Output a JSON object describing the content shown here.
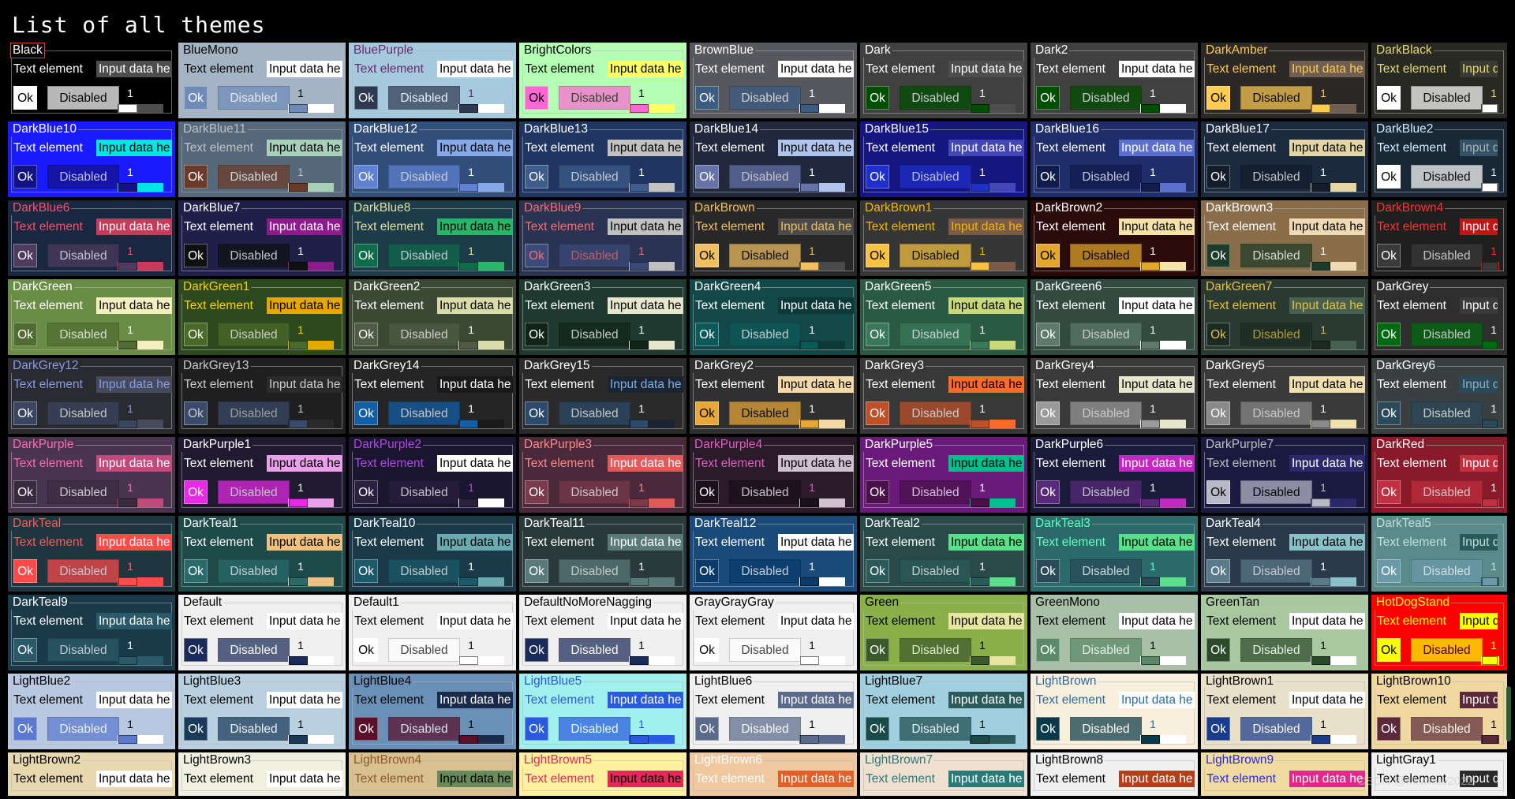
{
  "page": {
    "title": "List of all themes",
    "watermark": "CSDN @Mrwhite2022"
  },
  "labels": {
    "text_element": "Text element",
    "input_value": "Input data he",
    "input_value_narrow": "Input d",
    "ok": "Ok",
    "disabled": "Disabled",
    "slider_value": "1"
  },
  "themes": [
    {
      "name": "Black",
      "bg": "#000000",
      "fg": "#ffffff",
      "in_bg": "#4d4d4d",
      "in_fg": "#ffffff",
      "btn_bg": "#ffffff",
      "btn_fg": "#000000",
      "selected": true
    },
    {
      "name": "BlueMono",
      "bg": "#a5b4c4",
      "fg": "#000000",
      "in_bg": "#ffffff",
      "in_fg": "#000000",
      "btn_bg": "#6f8bba",
      "btn_fg": "#ffffff"
    },
    {
      "name": "BluePurple",
      "bg": "#a5cadd",
      "fg": "#6e266e",
      "in_bg": "#ffffff",
      "in_fg": "#000000",
      "btn_bg": "#303952",
      "btn_fg": "#ffffff"
    },
    {
      "name": "BrightColors",
      "bg": "#b4ffb4",
      "fg": "#000000",
      "in_bg": "#ffff66",
      "in_fg": "#000000",
      "btn_bg": "#fc67d3",
      "btn_fg": "#000000"
    },
    {
      "name": "BrownBlue",
      "bg": "#57575e",
      "fg": "#ffffff",
      "in_bg": "#ffffff",
      "in_fg": "#000000",
      "btn_bg": "#3c5c82",
      "btn_fg": "#ffffff"
    },
    {
      "name": "Dark",
      "bg": "#404040",
      "fg": "#ffffff",
      "in_bg": "#4d4d4d",
      "in_fg": "#ffffff",
      "btn_bg": "#004f00",
      "btn_fg": "#ffffff"
    },
    {
      "name": "Dark2",
      "bg": "#404040",
      "fg": "#ffffff",
      "in_bg": "#ffffff",
      "in_fg": "#000000",
      "btn_bg": "#004f00",
      "btn_fg": "#ffffff"
    },
    {
      "name": "DarkAmber",
      "bg": "#2c2825",
      "fg": "#fdcb52",
      "in_bg": "#705e52",
      "in_fg": "#fdcb52",
      "btn_bg": "#fdcb52",
      "btn_fg": "#000000"
    },
    {
      "name": "DarkBlack",
      "bg": "#282923",
      "fg": "#e7db74",
      "in_bg": "#393a32",
      "in_fg": "#e7db74",
      "btn_bg": "#ffffff",
      "btn_fg": "#000000"
    },
    {
      "name": "DarkBlue10",
      "bg": "#1a1aff",
      "fg": "#ffffff",
      "in_bg": "#00e6e6",
      "in_fg": "#000000",
      "btn_bg": "#121285",
      "btn_fg": "#ffffff"
    },
    {
      "name": "DarkBlue11",
      "bg": "#56697c",
      "fg": "#c0c0c0",
      "in_bg": "#a8d0b8",
      "in_fg": "#000000",
      "btn_bg": "#6c3a2a",
      "btn_fg": "#ffffff"
    },
    {
      "name": "DarkBlue12",
      "bg": "#324e7b",
      "fg": "#ffffff",
      "in_bg": "#86a8e7",
      "in_fg": "#000000",
      "btn_bg": "#5f81d3",
      "btn_fg": "#ffffff"
    },
    {
      "name": "DarkBlue13",
      "bg": "#203562",
      "fg": "#ffffff",
      "in_bg": "#c2c2c2",
      "in_fg": "#000000",
      "btn_bg": "#3e5c8c",
      "btn_fg": "#ffffff"
    },
    {
      "name": "DarkBlue14",
      "bg": "#21273d",
      "fg": "#ffffff",
      "in_bg": "#b1c4ec",
      "in_fg": "#000000",
      "btn_bg": "#6573a8",
      "btn_fg": "#ffffff"
    },
    {
      "name": "DarkBlue15",
      "bg": "#151680",
      "fg": "#ffffff",
      "in_bg": "#4346b5",
      "in_fg": "#ffffff",
      "btn_bg": "#1e2fcc",
      "btn_fg": "#ffffff"
    },
    {
      "name": "DarkBlue16",
      "bg": "#1f2e6a",
      "fg": "#ffffff",
      "in_bg": "#5b6fcc",
      "in_fg": "#ffffff",
      "btn_bg": "#101c4d",
      "btn_fg": "#ffffff"
    },
    {
      "name": "DarkBlue17",
      "bg": "#1c2a40",
      "fg": "#ffffff",
      "in_bg": "#e3d5a6",
      "in_fg": "#000000",
      "btn_bg": "#131c2a",
      "btn_fg": "#ffffff"
    },
    {
      "name": "DarkBlue2",
      "bg": "#1a2835",
      "fg": "#d1ecff",
      "in_bg": "#335267",
      "in_fg": "#acb1b4",
      "btn_bg": "#ffffff",
      "btn_fg": "#000000"
    },
    {
      "name": "DarkBlue6",
      "bg": "#1a2740",
      "fg": "#ff4d6d",
      "in_bg": "#c73a5a",
      "in_fg": "#ffffff",
      "btn_bg": "#4e3b5f",
      "btn_fg": "#ffffff"
    },
    {
      "name": "DarkBlue7",
      "bg": "#1f1f4a",
      "fg": "#ffffff",
      "in_bg": "#8c1b8c",
      "in_fg": "#ffffff",
      "btn_bg": "#101010",
      "btn_fg": "#ffffff"
    },
    {
      "name": "DarkBlue8",
      "bg": "#1c3c48",
      "fg": "#e0e0a0",
      "in_bg": "#2ab56a",
      "in_fg": "#000000",
      "btn_bg": "#0e6b4b",
      "btn_fg": "#ffffff"
    },
    {
      "name": "DarkBlue9",
      "bg": "#2a3352",
      "fg": "#ff6b6b",
      "in_bg": "#c0c0c0",
      "in_fg": "#000000",
      "btn_bg": "#3a4a7a",
      "btn_fg": "#ff6b6b"
    },
    {
      "name": "DarkBrown",
      "bg": "#282828",
      "fg": "#f0c060",
      "in_bg": "#4a4a4a",
      "in_fg": "#f0c060",
      "btn_bg": "#f0c060",
      "btn_fg": "#000000"
    },
    {
      "name": "DarkBrown1",
      "bg": "#363636",
      "fg": "#f5b800",
      "in_bg": "#7a5b48",
      "in_fg": "#f5b800",
      "btn_bg": "#f5c242",
      "btn_fg": "#000000"
    },
    {
      "name": "DarkBrown2",
      "bg": "#2b0a0a",
      "fg": "#ffffff",
      "in_bg": "#f5e2a8",
      "in_fg": "#000000",
      "btn_bg": "#e3a72a",
      "btn_fg": "#000000"
    },
    {
      "name": "DarkBrown3",
      "bg": "#8a6e4b",
      "fg": "#ffffff",
      "in_bg": "#f0dab5",
      "in_fg": "#000000",
      "btn_bg": "#1d3c2a",
      "btn_fg": "#ffffff"
    },
    {
      "name": "DarkBrown4",
      "bg": "#1f1f1f",
      "fg": "#ff3030",
      "in_bg": "#c01515",
      "in_fg": "#ffffff",
      "btn_bg": "#3a3a3a",
      "btn_fg": "#ffffff"
    },
    {
      "name": "DarkGreen",
      "bg": "#6a8d45",
      "fg": "#ffffff",
      "in_bg": "#f5eec0",
      "in_fg": "#000000",
      "btn_bg": "#516b32",
      "btn_fg": "#ffffff"
    },
    {
      "name": "DarkGreen1",
      "bg": "#2d4a1e",
      "fg": "#ffd000",
      "in_bg": "#e4a900",
      "in_fg": "#000000",
      "btn_bg": "#4a6a2a",
      "btn_fg": "#ffffff"
    },
    {
      "name": "DarkGreen2",
      "bg": "#3c4a35",
      "fg": "#ffffff",
      "in_bg": "#d8dcaa",
      "in_fg": "#000000",
      "btn_bg": "#4f5b45",
      "btn_fg": "#ffffff"
    },
    {
      "name": "DarkGreen3",
      "bg": "#1f3a30",
      "fg": "#ffffff",
      "in_bg": "#e6e6cc",
      "in_fg": "#000000",
      "btn_bg": "#102418",
      "btn_fg": "#ffffff"
    },
    {
      "name": "DarkGreen4",
      "bg": "#134848",
      "fg": "#ffffff",
      "in_bg": "#0d3838",
      "in_fg": "#ffffff",
      "btn_bg": "#0b5a5a",
      "btn_fg": "#ffffff"
    },
    {
      "name": "DarkGreen5",
      "bg": "#2a5a42",
      "fg": "#ffffff",
      "in_bg": "#c9d87a",
      "in_fg": "#000000",
      "btn_bg": "#3a7a5a",
      "btn_fg": "#ffffff"
    },
    {
      "name": "DarkGreen6",
      "bg": "#334a40",
      "fg": "#ffffff",
      "in_bg": "#ffffff",
      "in_fg": "#000000",
      "btn_bg": "#5d7a6d",
      "btn_fg": "#ffffff"
    },
    {
      "name": "DarkGreen7",
      "bg": "#2a3a32",
      "fg": "#e8c040",
      "in_bg": "#486050",
      "in_fg": "#e8c040",
      "btn_bg": "#1c2a24",
      "btn_fg": "#e8c040"
    },
    {
      "name": "DarkGrey",
      "bg": "#2e2e2e",
      "fg": "#ffffff",
      "in_bg": "#3a3a3a",
      "in_fg": "#ffffff",
      "btn_bg": "#006a10",
      "btn_fg": "#ffffff"
    },
    {
      "name": "DarkGrey12",
      "bg": "#2a2b30",
      "fg": "#8a9ae6",
      "in_bg": "#454a5c",
      "in_fg": "#8a9ae6",
      "btn_bg": "#3a4660",
      "btn_fg": "#ffffff"
    },
    {
      "name": "DarkGrey13",
      "bg": "#1f1f1f",
      "fg": "#cccccc",
      "in_bg": "#2a2a2a",
      "in_fg": "#cccccc",
      "btn_bg": "#3a4a6a",
      "btn_fg": "#cccccc"
    },
    {
      "name": "DarkGrey14",
      "bg": "#252525",
      "fg": "#ffffff",
      "in_bg": "#1a1a1a",
      "in_fg": "#ffffff",
      "btn_bg": "#125fa8",
      "btn_fg": "#ffffff"
    },
    {
      "name": "DarkGrey15",
      "bg": "#2a2a2a",
      "fg": "#ffffff",
      "in_bg": "#1c2433",
      "in_fg": "#7ab0e0",
      "btn_bg": "#2c4a6a",
      "btn_fg": "#ffffff"
    },
    {
      "name": "DarkGrey2",
      "bg": "#303030",
      "fg": "#ffffff",
      "in_bg": "#f5d8a8",
      "in_fg": "#000000",
      "btn_bg": "#e8a838",
      "btn_fg": "#000000"
    },
    {
      "name": "DarkGrey3",
      "bg": "#383838",
      "fg": "#ffffff",
      "in_bg": "#ff6a2a",
      "in_fg": "#000000",
      "btn_bg": "#c0502a",
      "btn_fg": "#ffffff"
    },
    {
      "name": "DarkGrey4",
      "bg": "#3a3a3a",
      "fg": "#ffffff",
      "in_bg": "#e6e6cc",
      "in_fg": "#000000",
      "btn_bg": "#9a9a9a",
      "btn_fg": "#ffffff"
    },
    {
      "name": "DarkGrey5",
      "bg": "#3a3a3a",
      "fg": "#ffffff",
      "in_bg": "#f0e0b0",
      "in_fg": "#000000",
      "btn_bg": "#8a8a8a",
      "btn_fg": "#ffffff"
    },
    {
      "name": "DarkGrey6",
      "bg": "#3a3f42",
      "fg": "#ffffff",
      "in_bg": "#2a4a5a",
      "in_fg": "#8ab0c8",
      "btn_bg": "#2a4a5a",
      "btn_fg": "#ffffff"
    },
    {
      "name": "DarkPurple",
      "bg": "#4a3550",
      "fg": "#ff6bb0",
      "in_bg": "#c04a7a",
      "in_fg": "#ffffff",
      "btn_bg": "#3a2a40",
      "btn_fg": "#ffffff"
    },
    {
      "name": "DarkPurple1",
      "bg": "#1f1a30",
      "fg": "#ffffff",
      "in_bg": "#e8a0e8",
      "in_fg": "#000000",
      "btn_bg": "#e62ae6",
      "btn_fg": "#ffffff"
    },
    {
      "name": "DarkPurple2",
      "bg": "#1a1530",
      "fg": "#b04ae0",
      "in_bg": "#ffffff",
      "in_fg": "#000000",
      "btn_bg": "#2a2040",
      "btn_fg": "#ffffff"
    },
    {
      "name": "DarkPurple3",
      "bg": "#4a2a3a",
      "fg": "#ff8a8a",
      "in_bg": "#e05a5a",
      "in_fg": "#ffffff",
      "btn_bg": "#7a3a4a",
      "btn_fg": "#ffffff"
    },
    {
      "name": "DarkPurple4",
      "bg": "#2a1a2a",
      "fg": "#e060c0",
      "in_bg": "#d0c0d0",
      "in_fg": "#000000",
      "btn_bg": "#1a101a",
      "btn_fg": "#ffffff"
    },
    {
      "name": "DarkPurple5",
      "bg": "#6a1a7a",
      "fg": "#ffffff",
      "in_bg": "#00c090",
      "in_fg": "#000000",
      "btn_bg": "#4a104a",
      "btn_fg": "#ffffff"
    },
    {
      "name": "DarkPurple6",
      "bg": "#1a1a3a",
      "fg": "#ffffff",
      "in_bg": "#c02ac0",
      "in_fg": "#ffffff",
      "btn_bg": "#5a2a7a",
      "btn_fg": "#ffffff"
    },
    {
      "name": "DarkPurple7",
      "bg": "#1a1a40",
      "fg": "#c0c0c0",
      "in_bg": "#2a2a6a",
      "in_fg": "#ffffff",
      "btn_bg": "#b8b8c8",
      "btn_fg": "#000000"
    },
    {
      "name": "DarkRed",
      "bg": "#8a1a2a",
      "fg": "#ffffff",
      "in_bg": "#c03040",
      "in_fg": "#ffffff",
      "btn_bg": "#c03040",
      "btn_fg": "#ffffff"
    },
    {
      "name": "DarkTeal",
      "bg": "#1f3540",
      "fg": "#ff5a5a",
      "in_bg": "#ff4a4a",
      "in_fg": "#ffffff",
      "btn_bg": "#ff4a4a",
      "btn_fg": "#ffffff"
    },
    {
      "name": "DarkTeal1",
      "bg": "#1f4a4a",
      "fg": "#ffffff",
      "in_bg": "#f0c080",
      "in_fg": "#000000",
      "btn_bg": "#2a6a6a",
      "btn_fg": "#ffffff"
    },
    {
      "name": "DarkTeal10",
      "bg": "#1a3a4a",
      "fg": "#ffffff",
      "in_bg": "#6aaab0",
      "in_fg": "#000000",
      "btn_bg": "#1a5a6a",
      "btn_fg": "#ffffff"
    },
    {
      "name": "DarkTeal11",
      "bg": "#2a3a3a",
      "fg": "#ffffff",
      "in_bg": "#5a7a7a",
      "in_fg": "#ffffff",
      "btn_bg": "#5a7a7a",
      "btn_fg": "#ffffff"
    },
    {
      "name": "DarkTeal12",
      "bg": "#1a4a7a",
      "fg": "#ffffff",
      "in_bg": "#ffffff",
      "in_fg": "#000000",
      "btn_bg": "#0a3a6a",
      "btn_fg": "#ffffff"
    },
    {
      "name": "DarkTeal2",
      "bg": "#2a4a4a",
      "fg": "#ffffff",
      "in_bg": "#5ae08a",
      "in_fg": "#000000",
      "btn_bg": "#2a5a5a",
      "btn_fg": "#ffffff"
    },
    {
      "name": "DarkTeal3",
      "bg": "#2a6a6a",
      "fg": "#60ffc0",
      "in_bg": "#5ae08a",
      "in_fg": "#000000",
      "btn_bg": "#2a4a5a",
      "btn_fg": "#ffffff"
    },
    {
      "name": "DarkTeal4",
      "bg": "#2a3a4a",
      "fg": "#ffffff",
      "in_bg": "#8ac0c8",
      "in_fg": "#000000",
      "btn_bg": "#5a7a8a",
      "btn_fg": "#ffffff"
    },
    {
      "name": "DarkTeal5",
      "bg": "#5a8a8a",
      "fg": "#c0e0e0",
      "in_bg": "#2a5a5a",
      "in_fg": "#c0e0e0",
      "btn_bg": "#6a9aaa",
      "btn_fg": "#ffffff"
    },
    {
      "name": "DarkTeal9",
      "bg": "#1a3a4a",
      "fg": "#ffffff",
      "in_bg": "#2a5a6a",
      "in_fg": "#ffffff",
      "btn_bg": "#2a5a6a",
      "btn_fg": "#ffffff"
    },
    {
      "name": "Default",
      "bg": "#f0f0f0",
      "fg": "#000000",
      "in_bg": "#ffffff",
      "in_fg": "#000000",
      "btn_bg": "#1a2a5a",
      "btn_fg": "#ffffff"
    },
    {
      "name": "Default1",
      "bg": "#f0f0f0",
      "fg": "#000000",
      "in_bg": "#ffffff",
      "in_fg": "#000000",
      "btn_bg": "#ffffff",
      "btn_fg": "#000000"
    },
    {
      "name": "DefaultNoMoreNagging",
      "bg": "#f0f0f0",
      "fg": "#000000",
      "in_bg": "#ffffff",
      "in_fg": "#000000",
      "btn_bg": "#1a2a5a",
      "btn_fg": "#ffffff"
    },
    {
      "name": "GrayGrayGray",
      "bg": "#f0f0f0",
      "fg": "#000000",
      "in_bg": "#ffffff",
      "in_fg": "#000000",
      "btn_bg": "#ffffff",
      "btn_fg": "#000000"
    },
    {
      "name": "Green",
      "bg": "#8ab04a",
      "fg": "#000000",
      "in_bg": "#e6e6a0",
      "in_fg": "#000000",
      "btn_bg": "#3a5a2a",
      "btn_fg": "#ffffff"
    },
    {
      "name": "GreenMono",
      "bg": "#a8c0a8",
      "fg": "#000000",
      "in_bg": "#ffffff",
      "in_fg": "#000000",
      "btn_bg": "#5a8a6a",
      "btn_fg": "#ffffff"
    },
    {
      "name": "GreenTan",
      "bg": "#a8c8a0",
      "fg": "#000000",
      "in_bg": "#ffffff",
      "in_fg": "#000000",
      "btn_bg": "#2a4a2a",
      "btn_fg": "#ffffff"
    },
    {
      "name": "HotDogStand",
      "bg": "#ff0000",
      "fg": "#ffff00",
      "in_bg": "#ffff00",
      "in_fg": "#000000",
      "btn_bg": "#ffff00",
      "btn_fg": "#000000"
    },
    {
      "name": "LightBlue2",
      "bg": "#b8c8e0",
      "fg": "#000000",
      "in_bg": "#ffffff",
      "in_fg": "#000000",
      "btn_bg": "#5a7ad0",
      "btn_fg": "#ffffff"
    },
    {
      "name": "LightBlue3",
      "bg": "#b8d0e0",
      "fg": "#000000",
      "in_bg": "#ffffff",
      "in_fg": "#000000",
      "btn_bg": "#1a3a5a",
      "btn_fg": "#ffffff"
    },
    {
      "name": "LightBlue4",
      "bg": "#6a90b8",
      "fg": "#000000",
      "in_bg": "#1a2a4a",
      "in_fg": "#ffffff",
      "btn_bg": "#5a102a",
      "btn_fg": "#ffffff"
    },
    {
      "name": "LightBlue5",
      "bg": "#a0f0f0",
      "fg": "#2a5ae0",
      "in_bg": "#2a5ae0",
      "in_fg": "#ffffff",
      "btn_bg": "#2a5ae0",
      "btn_fg": "#ffffff"
    },
    {
      "name": "LightBlue6",
      "bg": "#f0f0f0",
      "fg": "#000000",
      "in_bg": "#5a6a8a",
      "in_fg": "#ffffff",
      "btn_bg": "#5a6a8a",
      "btn_fg": "#ffffff"
    },
    {
      "name": "LightBlue7",
      "bg": "#a0d0e0",
      "fg": "#000000",
      "in_bg": "#2a5a5a",
      "in_fg": "#ffffff",
      "btn_bg": "#1a4a4a",
      "btn_fg": "#ffffff"
    },
    {
      "name": "LightBrown",
      "bg": "#f8f0dc",
      "fg": "#2a6aa0",
      "in_bg": "#ffffff",
      "in_fg": "#2a6aa0",
      "btn_bg": "#0a3a4a",
      "btn_fg": "#ffffff"
    },
    {
      "name": "LightBrown1",
      "bg": "#e8e0c8",
      "fg": "#000000",
      "in_bg": "#ffffff",
      "in_fg": "#000000",
      "btn_bg": "#1a3a8a",
      "btn_fg": "#ffffff"
    },
    {
      "name": "LightBrown10",
      "bg": "#f0d8a0",
      "fg": "#000000",
      "in_bg": "#5a2a3a",
      "in_fg": "#ffffff",
      "btn_bg": "#5a2a3a",
      "btn_fg": "#ffffff"
    },
    {
      "name": "LightBrown2",
      "bg": "#e8d8b0",
      "fg": "#000000",
      "in_bg": "#ffffff",
      "in_fg": "#000000",
      "btn_bg": "#8a6a4a",
      "btn_fg": "#ffffff"
    },
    {
      "name": "LightBrown3",
      "bg": "#f0f0e0",
      "fg": "#000000",
      "in_bg": "#ffffff",
      "in_fg": "#000000",
      "btn_bg": "#6a8aa0",
      "btn_fg": "#ffffff"
    },
    {
      "name": "LightBrown4",
      "bg": "#d8c090",
      "fg": "#8a5a2a",
      "in_bg": "#6a8a5a",
      "in_fg": "#000000",
      "btn_bg": "#6a8a5a",
      "btn_fg": "#ffffff"
    },
    {
      "name": "LightBrown5",
      "bg": "#fff0a0",
      "fg": "#e02a5a",
      "in_bg": "#e02a5a",
      "in_fg": "#000000",
      "btn_bg": "#e02a5a",
      "btn_fg": "#ffffff"
    },
    {
      "name": "LightBrown6",
      "bg": "#f0c8a0",
      "fg": "#ffffff",
      "in_bg": "#e0602a",
      "in_fg": "#ffffff",
      "btn_bg": "#e0602a",
      "btn_fg": "#ffffff"
    },
    {
      "name": "LightBrown7",
      "bg": "#f0e0d0",
      "fg": "#2a7a7a",
      "in_bg": "#2a7a7a",
      "in_fg": "#ffffff",
      "btn_bg": "#2a7a7a",
      "btn_fg": "#ffffff"
    },
    {
      "name": "LightBrown8",
      "bg": "#f0f0f0",
      "fg": "#000000",
      "in_bg": "#b0401a",
      "in_fg": "#ffffff",
      "btn_bg": "#b0401a",
      "btn_fg": "#ffffff"
    },
    {
      "name": "LightBrown9",
      "bg": "#f0dca0",
      "fg": "#2a2ae0",
      "in_bg": "#e02a8a",
      "in_fg": "#ffffff",
      "btn_bg": "#e02a8a",
      "btn_fg": "#ffffff"
    },
    {
      "name": "LightGray1",
      "bg": "#f0f0f0",
      "fg": "#000000",
      "in_bg": "#2a2a2a",
      "in_fg": "#ffffff",
      "btn_bg": "#2a2a2a",
      "btn_fg": "#ffffff"
    }
  ]
}
